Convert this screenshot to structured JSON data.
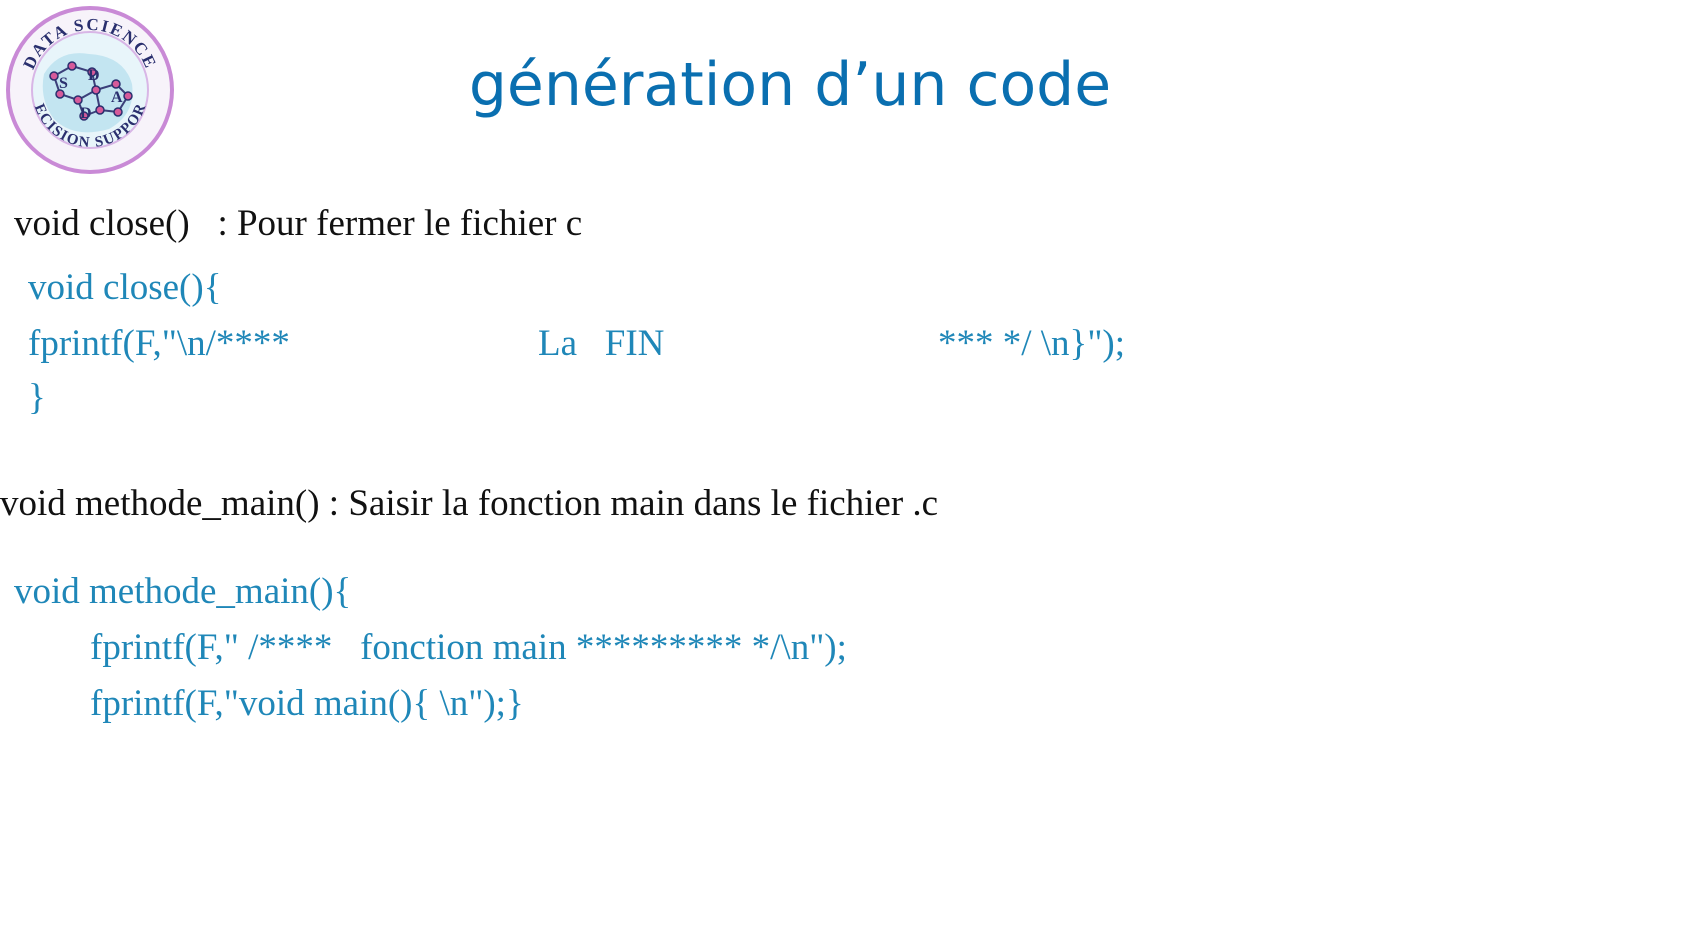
{
  "logo": {
    "ring_top_text": "DATA SCIENCE",
    "ring_bottom_text": "DECISION SUPPORT",
    "center_letters": [
      "S",
      "D",
      "D",
      "A"
    ],
    "colors": {
      "ring": "#c98ad6",
      "text": "#2a2f6e",
      "nodes": "#d65a9a",
      "fill": "#bfe3ef"
    }
  },
  "title": "génération d’un code",
  "sections": {
    "close": {
      "description": "void close()   : Pour fermer le fichier c",
      "code": [
        "void close(){",
        {
          "part1": "fprintf(F,\"\\n/****",
          "part2": "La   FIN",
          "part3": "*** */ \\n}\");"
        },
        "}"
      ]
    },
    "main": {
      "description": "void methode_main() : Saisir la fonction main dans le fichier .c",
      "code": [
        "void methode_main(){",
        "fprintf(F,\" /****   fonction main ********* */\\n\");",
        "fprintf(F,\"void main(){ \\n\");}"
      ]
    }
  },
  "colors": {
    "title": "#0a6fb0",
    "code": "#1f87b8",
    "text": "#111111",
    "background": "#ffffff"
  }
}
